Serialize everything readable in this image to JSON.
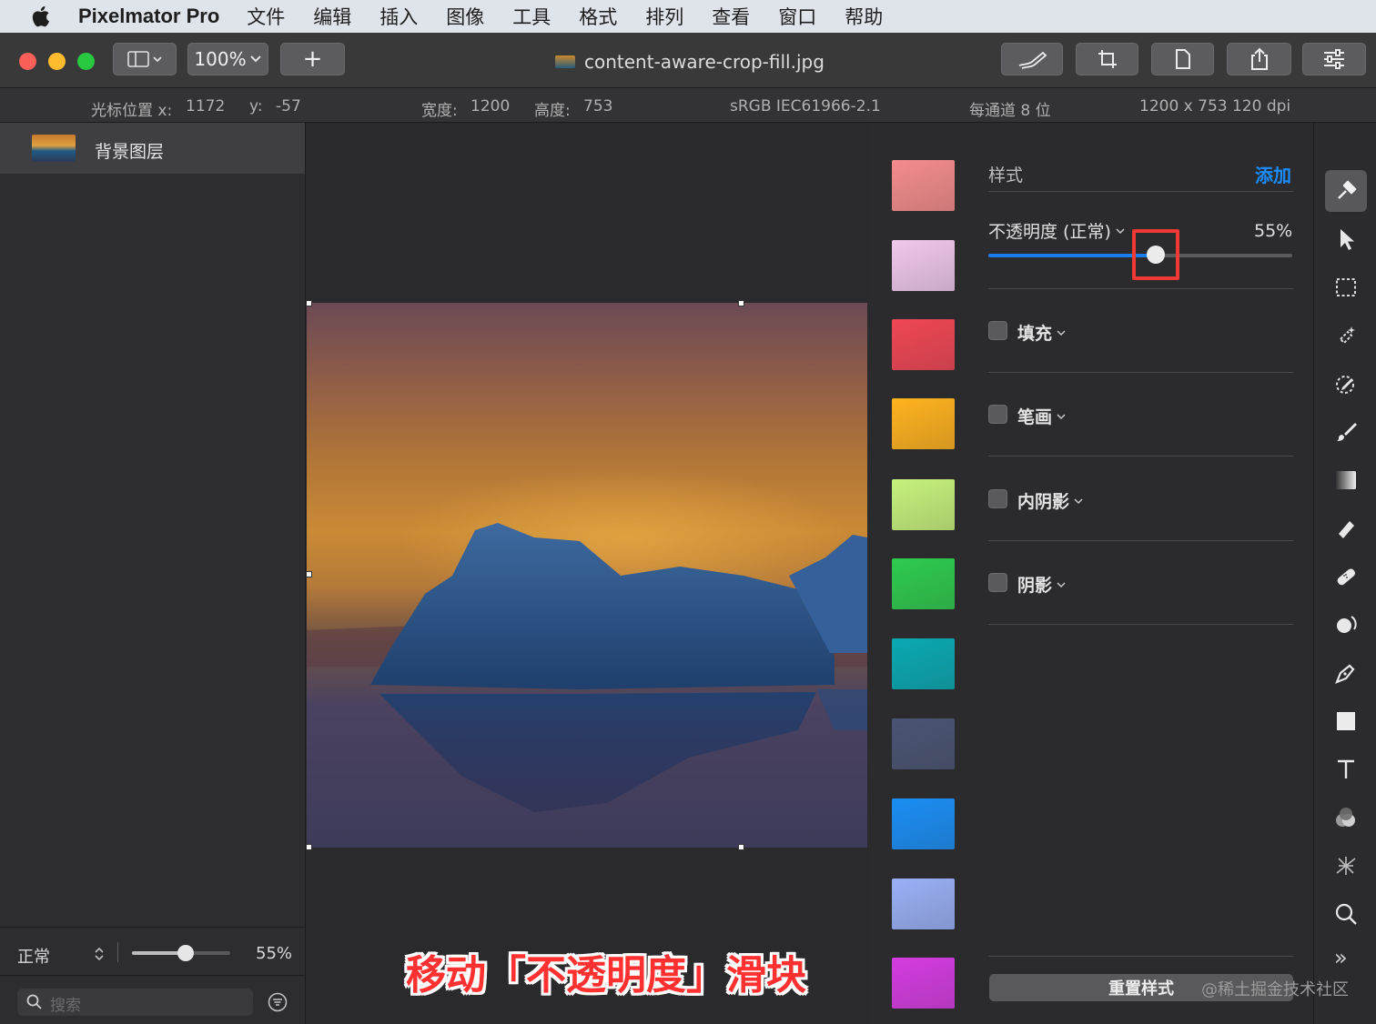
{
  "menubar": {
    "app_name": "Pixelmator Pro",
    "items": [
      "文件",
      "编辑",
      "插入",
      "图像",
      "工具",
      "格式",
      "排列",
      "查看",
      "窗口",
      "帮助"
    ]
  },
  "toolbar": {
    "zoom": "100%",
    "add_label": "+",
    "document_title": "content-aware-crop-fill.jpg"
  },
  "infobar": {
    "cursor_label": "光标位置 x:",
    "cursor_x": "1172",
    "cursor_y_label": "y:",
    "cursor_y": "-57",
    "width_label": "宽度:",
    "width": "1200",
    "height_label": "高度:",
    "height": "753",
    "color_profile": "sRGB IEC61966-2.1",
    "bit_depth": "每通道 8 位",
    "dimensions": "1200 x 753 120 dpi"
  },
  "layers": {
    "items": [
      {
        "name": "背景图层"
      }
    ],
    "blend_mode": "正常",
    "opacity": "55%",
    "opacity_value": 0.55,
    "search_placeholder": "搜索"
  },
  "swatches": [
    "#f48c8c",
    "#f0c8ec",
    "#f04654",
    "#ffb21e",
    "#c6f27c",
    "#2ecb4e",
    "#0aa9b2",
    "#4a5472",
    "#1a8ef4",
    "#9ab0f6",
    "#d43ce0"
  ],
  "style_panel": {
    "title": "样式",
    "add_label": "添加",
    "opacity_label": "不透明度 (正常)",
    "opacity_value_text": "55%",
    "opacity_value": 0.55,
    "effects": [
      {
        "label": "填充",
        "checked": false
      },
      {
        "label": "笔画",
        "checked": false
      },
      {
        "label": "内阴影",
        "checked": false
      },
      {
        "label": "阴影",
        "checked": false
      }
    ],
    "reset_label": "重置样式"
  },
  "tools": [
    "style-tool-icon",
    "arrange-pointer-icon",
    "rect-select-icon",
    "magic-select-icon",
    "color-picker-icon",
    "paint-brush-icon",
    "gradient-icon",
    "eraser-icon",
    "repair-icon",
    "distort-icon",
    "pen-icon",
    "shape-icon",
    "type-icon",
    "color-adjust-icon",
    "effects-icon",
    "zoom-icon"
  ],
  "tools_more": "»",
  "caption": "移动「不透明度」滑块",
  "watermark": "@稀土掘金技术社区"
}
